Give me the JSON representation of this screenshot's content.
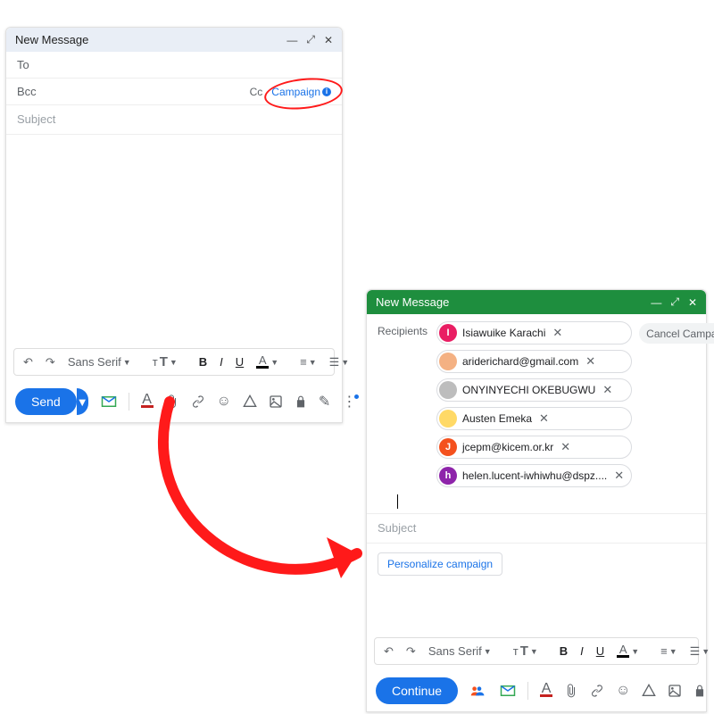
{
  "left": {
    "title": "New Message",
    "to_label": "To",
    "bcc_label": "Bcc",
    "cc_label": "Cc",
    "campaign_label": "Campaign",
    "subject_placeholder": "Subject",
    "font_label": "Sans Serif",
    "send_label": "Send"
  },
  "right": {
    "title": "New Message",
    "recipients_label": "Recipients",
    "cancel_label": "Cancel Campaign",
    "chips": [
      {
        "name": "Isiawuike Karachi",
        "bg": "#e91e63",
        "letter": "I"
      },
      {
        "name": "ariderichard@gmail.com",
        "bg": "#f4b183",
        "letter": ""
      },
      {
        "name": "ONYINYECHI OKEBUGWU",
        "bg": "#bdbdbd",
        "letter": ""
      },
      {
        "name": "Austen Emeka",
        "bg": "#ffd966",
        "letter": ""
      },
      {
        "name": "jcepm@kicem.or.kr",
        "bg": "#f4511e",
        "letter": "J"
      },
      {
        "name": "helen.lucent-iwhiwhu@dspz....",
        "bg": "#8e24aa",
        "letter": "h"
      }
    ],
    "subject_placeholder": "Subject",
    "personalize_label": "Personalize campaign",
    "font_label": "Sans Serif",
    "send_label": "Continue"
  },
  "toolbar": {
    "bold": "B",
    "italic": "I",
    "underline": "U",
    "fontA": "A",
    "size": "тT"
  }
}
